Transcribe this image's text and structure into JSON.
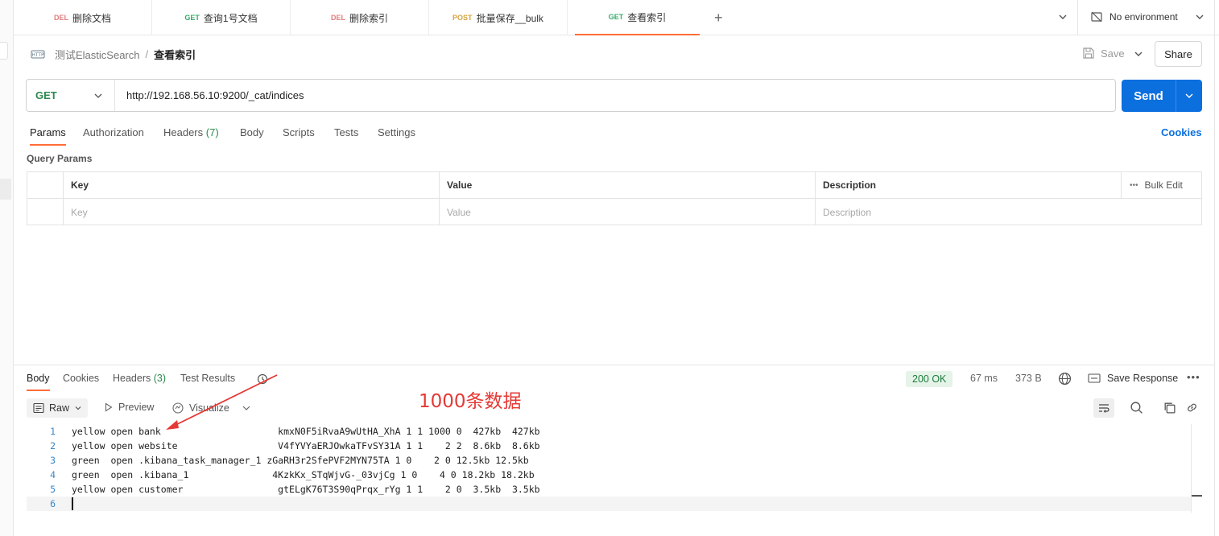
{
  "tabs": [
    {
      "method": "DEL",
      "label": "删除文档"
    },
    {
      "method": "GET",
      "label": "查询1号文档"
    },
    {
      "method": "DEL",
      "label": "删除索引"
    },
    {
      "method": "POST",
      "label": "批量保存__bulk"
    },
    {
      "method": "GET",
      "label": "查看索引"
    }
  ],
  "environment": "No environment",
  "breadcrumb": {
    "collection": "测试ElasticSearch",
    "separator": "/",
    "current": "查看索引"
  },
  "header": {
    "save_label": "Save",
    "share_label": "Share"
  },
  "request": {
    "method": "GET",
    "url": "http://192.168.56.10:9200/_cat/indices",
    "send_label": "Send"
  },
  "request_tabs": {
    "params": "Params",
    "authorization": "Authorization",
    "headers": "Headers",
    "headers_count": "(7)",
    "body": "Body",
    "scripts": "Scripts",
    "tests": "Tests",
    "settings": "Settings",
    "cookies": "Cookies"
  },
  "query_params": {
    "title": "Query Params",
    "columns": {
      "key": "Key",
      "value": "Value",
      "description": "Description"
    },
    "bulk_edit": "Bulk Edit",
    "placeholders": {
      "key": "Key",
      "value": "Value",
      "description": "Description"
    }
  },
  "response_tabs": {
    "body": "Body",
    "cookies": "Cookies",
    "headers": "Headers",
    "headers_count": "(3)",
    "test_results": "Test Results"
  },
  "response_meta": {
    "status": "200 OK",
    "time": "67 ms",
    "size": "373 B",
    "save_response": "Save Response"
  },
  "format_bar": {
    "raw": "Raw",
    "preview": "Preview",
    "visualize": "Visualize"
  },
  "response_lines": [
    {
      "n": "1",
      "text": "yellow open bank                     kmxN0F5iRvaA9wUtHA_XhA 1 1 1000 0  427kb  427kb"
    },
    {
      "n": "2",
      "text": "yellow open website                  V4fYVYaERJOwkaTFvSY31A 1 1    2 2  8.6kb  8.6kb"
    },
    {
      "n": "3",
      "text": "green  open .kibana_task_manager_1 zGaRH3r2SfePVF2MYN75TA 1 0    2 0 12.5kb 12.5kb"
    },
    {
      "n": "4",
      "text": "green  open .kibana_1               4KzkKx_STqWjvG-_03vjCg 1 0    4 0 18.2kb 18.2kb"
    },
    {
      "n": "5",
      "text": "yellow open customer                 gtELgK76T3S90qPrqx_rYg 1 1    2 0  3.5kb  3.5kb"
    },
    {
      "n": "6",
      "text": ""
    }
  ],
  "annotation": "1000条数据",
  "colors": {
    "accent": "#ff6c37",
    "send": "#0b6fde",
    "get": "#36a96a",
    "del": "#e27d7d",
    "post": "#d6a33d",
    "annotation": "#e53935"
  }
}
